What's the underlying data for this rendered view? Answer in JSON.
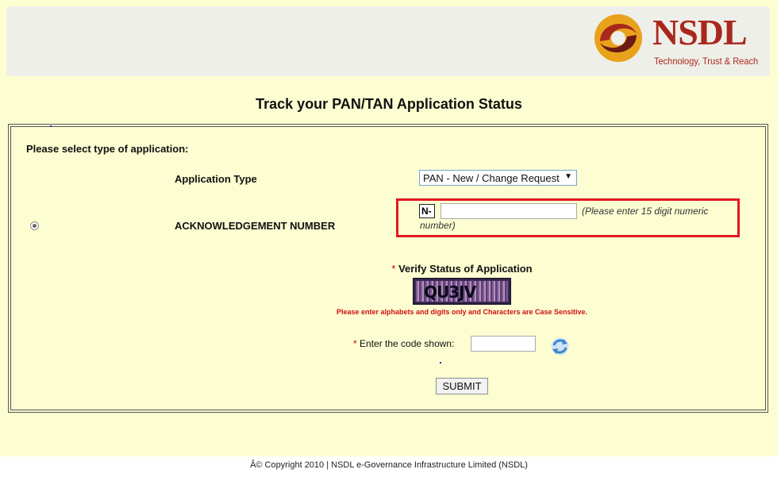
{
  "header": {
    "logo_text": "NSDL",
    "logo_tagline": "Technology, Trust & Reach"
  },
  "title": "Track your PAN/TAN Application Status",
  "form": {
    "select_type_label": "Please select type of application:",
    "application_type_label": "Application Type",
    "application_type_value": "PAN - New / Change Request",
    "ack_label": "ACKNOWLEDGEMENT NUMBER",
    "ack_prefix": "N-",
    "ack_value": "",
    "ack_hint_line1": "(Please enter 15 digit numeric",
    "ack_hint_line2": "number)",
    "verify_label": "Verify Status of Application",
    "captcha_text": "QU3JV",
    "captcha_warning": "Please enter alphabets and digits only and Characters are Case Sensitive.",
    "code_label": "Enter the code shown:",
    "code_value": "",
    "required_mark": "*",
    "submit_label": "SUBMIT"
  },
  "footer": {
    "copyright": "Â© Copyright 2010  |  NSDL e-Governance Infrastructure Limited (NSDL)"
  },
  "colors": {
    "page_background": "#fdfdd2",
    "brand_red": "#a8281d",
    "highlight_border": "#e0191f",
    "warning_text": "#d01010"
  },
  "icons": {
    "logo_mark": "nsdl-swirl-logo",
    "refresh": "refresh-icon",
    "dropdown": "chevron-down-icon"
  }
}
